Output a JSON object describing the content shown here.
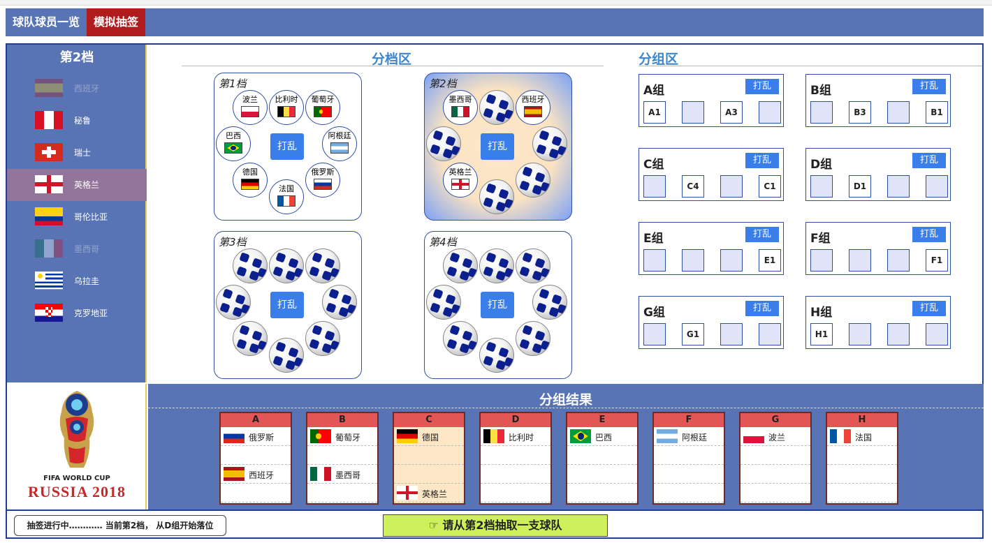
{
  "nav": {
    "tab_players": "球队球员一览",
    "tab_draw": "模拟抽签"
  },
  "sidebar": {
    "title": "第2档",
    "items": [
      {
        "name": "西班牙",
        "flag": "f-es",
        "state": "dim"
      },
      {
        "name": "秘鲁",
        "flag": "f-pe",
        "state": "normal"
      },
      {
        "name": "瑞士",
        "flag": "f-ch",
        "state": "normal"
      },
      {
        "name": "英格兰",
        "flag": "f-en",
        "state": "selected"
      },
      {
        "name": "哥伦比亚",
        "flag": "f-co",
        "state": "normal"
      },
      {
        "name": "墨西哥",
        "flag": "f-mx",
        "state": "dim"
      },
      {
        "name": "乌拉圭",
        "flag": "f-uy",
        "state": "normal"
      },
      {
        "name": "克罗地亚",
        "flag": "f-hr",
        "state": "normal"
      }
    ]
  },
  "logo": {
    "line1": "FIFA WORLD CUP",
    "line2": "RUSSIA 2018"
  },
  "pots_title": "分档区",
  "groups_title": "分组区",
  "shuffle_label": "打乱",
  "pots": [
    {
      "label": "第1档",
      "active": false,
      "slots": [
        {
          "team": "比利时",
          "flag": "f-be"
        },
        {
          "team": "葡萄牙",
          "flag": "f-pt"
        },
        {
          "team": "阿根廷",
          "flag": "f-ar"
        },
        {
          "team": "俄罗斯",
          "flag": "f-ru"
        },
        {
          "team": "法国",
          "flag": "f-fr"
        },
        {
          "team": "德国",
          "flag": "f-de"
        },
        {
          "team": "巴西",
          "flag": "f-br"
        },
        {
          "team": "波兰",
          "flag": "f-pl"
        }
      ]
    },
    {
      "label": "第2档",
      "active": true,
      "slots": [
        {
          "team": null
        },
        {
          "team": "西班牙",
          "flag": "f-es"
        },
        {
          "team": null
        },
        {
          "team": null
        },
        {
          "team": null
        },
        {
          "team": "英格兰",
          "flag": "f-en"
        },
        {
          "team": null
        },
        {
          "team": "墨西哥",
          "flag": "f-mx"
        }
      ]
    },
    {
      "label": "第3档",
      "active": false,
      "slots": [
        {
          "team": null
        },
        {
          "team": null
        },
        {
          "team": null
        },
        {
          "team": null
        },
        {
          "team": null
        },
        {
          "team": null
        },
        {
          "team": null
        },
        {
          "team": null
        }
      ]
    },
    {
      "label": "第4档",
      "active": false,
      "slots": [
        {
          "team": null
        },
        {
          "team": null
        },
        {
          "team": null
        },
        {
          "team": null
        },
        {
          "team": null
        },
        {
          "team": null
        },
        {
          "team": null
        },
        {
          "team": null
        }
      ]
    }
  ],
  "groups": [
    {
      "name": "A组",
      "slots": [
        "A1",
        "",
        "A3",
        ""
      ]
    },
    {
      "name": "B组",
      "slots": [
        "",
        "B3",
        "",
        "B1"
      ]
    },
    {
      "name": "C组",
      "slots": [
        "",
        "C4",
        "",
        "C1"
      ]
    },
    {
      "name": "D组",
      "slots": [
        "",
        "D1",
        "",
        ""
      ]
    },
    {
      "name": "E组",
      "slots": [
        "",
        "",
        "",
        "E1"
      ]
    },
    {
      "name": "F组",
      "slots": [
        "",
        "",
        "",
        "F1"
      ]
    },
    {
      "name": "G组",
      "slots": [
        "",
        "G1",
        "",
        ""
      ]
    },
    {
      "name": "H组",
      "slots": [
        "H1",
        "",
        "",
        ""
      ]
    }
  ],
  "results": {
    "title": "分组结果",
    "columns": [
      {
        "letter": "A",
        "active": false,
        "rows": [
          {
            "team": "俄罗斯",
            "flag": "f-ru",
            "pos": 0
          },
          {
            "team": "西班牙",
            "flag": "f-es",
            "pos": 2
          }
        ]
      },
      {
        "letter": "B",
        "active": false,
        "rows": [
          {
            "team": "葡萄牙",
            "flag": "f-pt",
            "pos": 0
          },
          {
            "team": "墨西哥",
            "flag": "f-mx",
            "pos": 2
          }
        ]
      },
      {
        "letter": "C",
        "active": true,
        "rows": [
          {
            "team": "德国",
            "flag": "f-de",
            "pos": 0
          },
          {
            "team": "英格兰",
            "flag": "f-en",
            "pos": 3
          }
        ]
      },
      {
        "letter": "D",
        "active": false,
        "rows": [
          {
            "team": "比利时",
            "flag": "f-be",
            "pos": 0
          }
        ]
      },
      {
        "letter": "E",
        "active": false,
        "rows": [
          {
            "team": "巴西",
            "flag": "f-br",
            "pos": 0
          }
        ]
      },
      {
        "letter": "F",
        "active": false,
        "rows": [
          {
            "team": "阿根廷",
            "flag": "f-ar",
            "pos": 0
          }
        ]
      },
      {
        "letter": "G",
        "active": false,
        "rows": [
          {
            "team": "波兰",
            "flag": "f-pl",
            "pos": 0
          }
        ]
      },
      {
        "letter": "H",
        "active": false,
        "rows": [
          {
            "team": "法国",
            "flag": "f-fr",
            "pos": 0
          }
        ]
      }
    ]
  },
  "footer": {
    "status": "抽签进行中………… 当前第2档， 从D组开始落位",
    "action": "☞ 请从第2档抽取一支球队"
  }
}
